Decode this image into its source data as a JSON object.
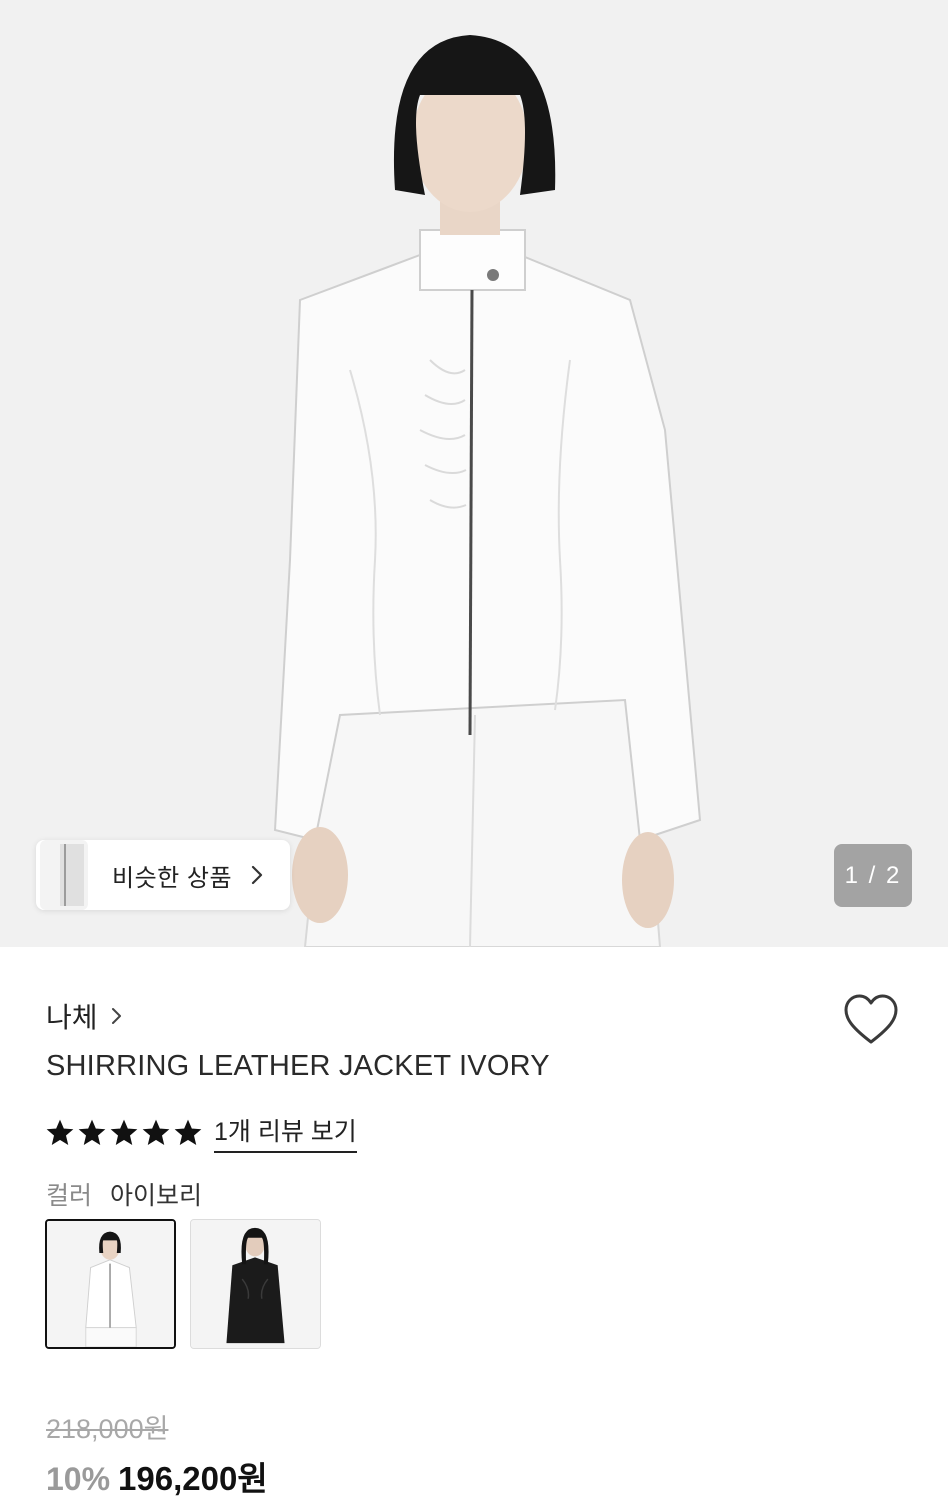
{
  "gallery": {
    "similar_label": "비슷한 상품",
    "page_indicator": "1 / 2"
  },
  "product": {
    "brand": "나체",
    "title": "SHIRRING LEATHER JACKET IVORY",
    "rating": 5,
    "rating_max": 5,
    "review_link": "1개 리뷰 보기",
    "color_label": "컬러",
    "color_value": "아이보리",
    "swatches": [
      "ivory",
      "black"
    ],
    "original_price": "218,000원",
    "discount": "10%",
    "sale_price": "196,200원"
  },
  "colors": {
    "star": "#111111",
    "indicator_bg": "#a3a3a3",
    "discount": "#9a9a9a"
  }
}
